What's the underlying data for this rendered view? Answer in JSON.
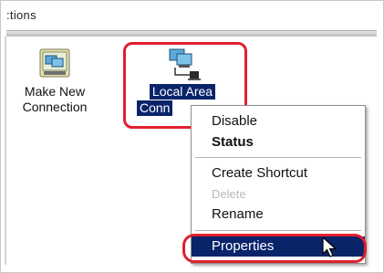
{
  "window": {
    "title_fragment": ":tions"
  },
  "icons": [
    {
      "label_line1": "Make New",
      "label_line2": "Connection",
      "icon": "make-new-connection-icon"
    },
    {
      "label_line1": "Local Area",
      "label_line2": "Conn",
      "icon": "local-area-connection-icon"
    }
  ],
  "context_menu": {
    "items": [
      {
        "label": "Disable",
        "state": "normal"
      },
      {
        "label": "Status",
        "state": "default-bold"
      },
      {
        "label": "Create Shortcut",
        "state": "normal"
      },
      {
        "label": "Delete",
        "state": "disabled"
      },
      {
        "label": "Rename",
        "state": "normal"
      },
      {
        "label": "Properties",
        "state": "selected"
      }
    ]
  },
  "colors": {
    "selection": "#0a246a",
    "highlight_annotation": "#e0202e",
    "disabled_text": "#b8b8b8"
  }
}
